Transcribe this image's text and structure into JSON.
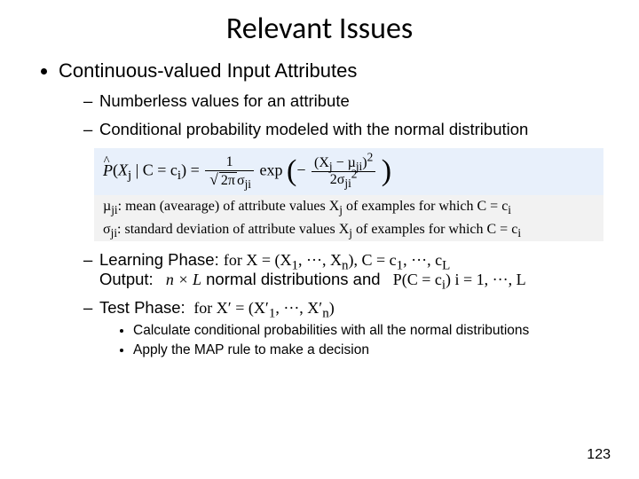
{
  "title": "Relevant Issues",
  "bullet1": "Continuous-valued Input Attributes",
  "sub1": "Numberless values for an attribute",
  "sub2": "Conditional probability modeled with the normal distribution",
  "formula_lhs": "P̂(X",
  "formula_sub_j": "j",
  "formula_mid1": " | C = c",
  "formula_sub_i": "i",
  "formula_eq": ") = ",
  "frac1_num": "1",
  "frac1_den_pre": "2π",
  "sigma": "σ",
  "mu": "µ",
  "sub_ji": "ji",
  "exp_label": " exp",
  "frac2_num_open": "(X",
  "frac2_num_minus": " − µ",
  "frac2_num_close": ")",
  "frac2_num_sq": "2",
  "frac2_den_pre": "2σ",
  "frac2_den_sq": "2",
  "def_mu": ": mean (avearage) of attribute values X",
  "def_mu_tail": " of examples  for which C = c",
  "def_sig": ": standard deviation of attribute values X",
  "def_sig_tail": " of examples for which C = c",
  "sub_j": "j",
  "sub_iu": "i",
  "learn_label": "Learning Phase:",
  "learn_for": "for X = (X",
  "learn_for_1": "1",
  "learn_for_dots": ", ···, X",
  "learn_for_n": "n",
  "learn_for_close": "),  C = c",
  "learn_for_c1": "1",
  "learn_for_dots2": ", ···, c",
  "learn_for_cL": "L",
  "output_label": "Output:",
  "output_nxl": "n × L",
  "output_text": "   normal distributions and",
  "output_pc": "P(C = c",
  "output_pc_i": "i",
  "output_pc_close": ")  i = 1, ···, L",
  "test_label": "Test Phase:",
  "test_for": "for  X′ = (X′",
  "test_for_1": "1",
  "test_for_dots": ", ···, X′",
  "test_for_n": "n",
  "test_for_close": ")",
  "step1": "Calculate conditional probabilities with all the normal distributions",
  "step2": "Apply the MAP rule to make a decision",
  "page": "123"
}
